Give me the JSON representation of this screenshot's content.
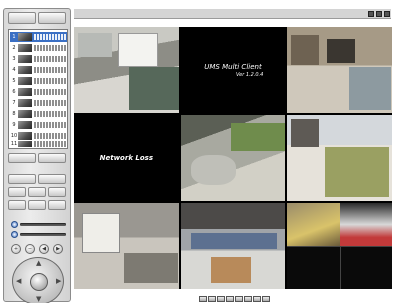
{
  "app": {
    "client_title": "UMS Multi Client",
    "version": "Ver 1.2.0.4"
  },
  "camera_list": {
    "items": [
      {
        "num": "1",
        "selected": true
      },
      {
        "num": "2",
        "selected": false
      },
      {
        "num": "3",
        "selected": false
      },
      {
        "num": "4",
        "selected": false
      },
      {
        "num": "5",
        "selected": false
      },
      {
        "num": "6",
        "selected": false
      },
      {
        "num": "7",
        "selected": false
      },
      {
        "num": "8",
        "selected": false
      },
      {
        "num": "9",
        "selected": false
      },
      {
        "num": "10",
        "selected": false
      },
      {
        "num": "11",
        "selected": false
      }
    ]
  },
  "tiles": [
    {
      "type": "camera",
      "scene": "cam1"
    },
    {
      "type": "message",
      "title": "UMS Multi Client",
      "subtitle": "Ver 1.2.0.4"
    },
    {
      "type": "camera",
      "scene": "cam3"
    },
    {
      "type": "message",
      "title": "Network Loss"
    },
    {
      "type": "camera",
      "scene": "cam5"
    },
    {
      "type": "camera",
      "scene": "cam6"
    },
    {
      "type": "camera",
      "scene": "cam7"
    },
    {
      "type": "camera",
      "scene": "cam8"
    },
    {
      "type": "camera",
      "scene": "cam9"
    }
  ],
  "colors": {
    "selection": "#3a6fc4",
    "view_background": "#000000",
    "panel": "#e0e0e0"
  },
  "icons": {
    "ptz_up": "▲",
    "ptz_down": "▼",
    "ptz_left": "◀",
    "ptz_right": "▶",
    "zoom_in": "+",
    "zoom_out": "−",
    "prev": "◀",
    "next": "▶"
  }
}
